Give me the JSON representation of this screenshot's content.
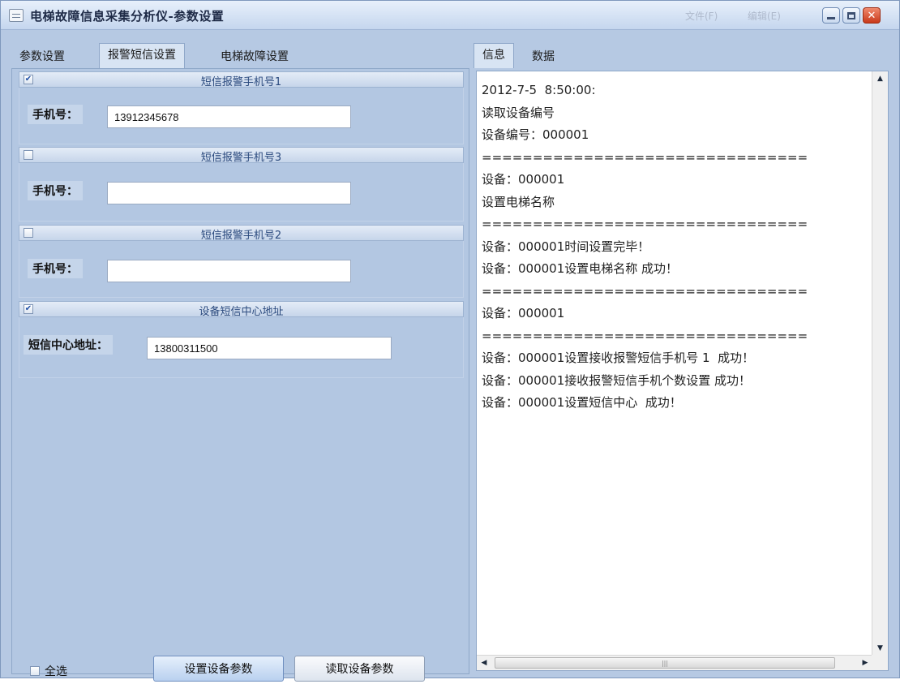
{
  "window": {
    "title": "电梯故障信息采集分析仪-参数设置",
    "menu": [
      "文件(F)",
      "编辑(E)"
    ],
    "colors": {
      "background": "#b6c9e3",
      "title_text": "#1e2a46",
      "group_title": "#2b4a7e",
      "close": "#c8391b"
    }
  },
  "left_tabs": [
    "参数设置",
    "报警短信设置",
    "电梯故障设置"
  ],
  "left_active_tab": "报警短信设置",
  "groups": [
    {
      "title": "短信报警手机号1",
      "checked": true,
      "field_label": "手机号：",
      "value": "13912345678"
    },
    {
      "title": "短信报警手机号3",
      "checked": false,
      "field_label": "手机号：",
      "value": ""
    },
    {
      "title": "短信报警手机号2",
      "checked": false,
      "field_label": "手机号：",
      "value": ""
    },
    {
      "title": "设备短信中心地址",
      "checked": true,
      "field_label": "短信中心地址：",
      "value": "13800311500"
    }
  ],
  "bottom": {
    "select_all_label": "全选",
    "select_all_checked": false,
    "set_button": "设置设备参数",
    "read_button": "读取设备参数"
  },
  "right_tabs": [
    "信息",
    "数据"
  ],
  "right_active_tab": "信息",
  "log_lines": [
    "2012-7-5  8:50:00:",
    "读取设备编号",
    "设备编号：000001",
    "================================",
    "设备：000001",
    "设置电梯名称",
    "================================",
    "设备：000001时间设置完毕！",
    "设备：000001设置电梯名称 成功！",
    "================================",
    "设备：000001",
    "================================",
    "设备：000001设置接收报警短信手机号 1  成功！",
    "设备：000001接收报警短信手机个数设置 成功！",
    "设备：000001设置短信中心  成功！"
  ],
  "icons": {
    "app": "window-menu-icon",
    "minimize": "minimize-icon",
    "maximize": "maximize-icon",
    "close": "close-icon",
    "scroll_up": "arrow-up-icon",
    "scroll_down": "arrow-down-icon",
    "scroll_left": "arrow-left-icon",
    "scroll_right": "arrow-right-icon"
  }
}
